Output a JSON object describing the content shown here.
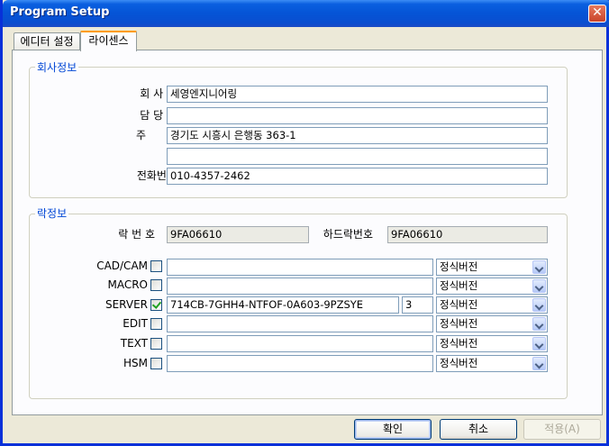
{
  "window": {
    "title": "Program Setup",
    "close_label": "✕"
  },
  "tabs": [
    {
      "label": "에디터 설정",
      "active": false
    },
    {
      "label": "라이센스",
      "active": true
    }
  ],
  "company": {
    "group_title": "회사정보",
    "name_label": "회 사 명",
    "name_value": "세영엔지니어링",
    "manager_label": "담 당 장",
    "manager_value": "",
    "address_label": "주      소",
    "address1_value": "경기도 시흥시 은행동 363-1",
    "address2_value": "",
    "phone_label": "전화번호",
    "phone_value": "010-4357-2462"
  },
  "lock": {
    "group_title": "락정보",
    "lock_no_label": "락 번 호",
    "lock_no_value": "9FA06610",
    "hw_lock_label": "하드락번호",
    "hw_lock_value": "9FA06610",
    "modules": [
      {
        "name": "CAD/CAM",
        "checked": false,
        "key": "",
        "count": null,
        "version": "정식버전"
      },
      {
        "name": "MACRO",
        "checked": false,
        "key": "",
        "count": null,
        "version": "정식버전"
      },
      {
        "name": "SERVER",
        "checked": true,
        "key": "714CB-7GHH4-NTFOF-0A603-9PZSYE",
        "count": "3",
        "version": "정식버전"
      },
      {
        "name": "EDIT",
        "checked": false,
        "key": "",
        "count": null,
        "version": "정식버전"
      },
      {
        "name": "TEXT",
        "checked": false,
        "key": "",
        "count": null,
        "version": "정식버전"
      },
      {
        "name": "HSM",
        "checked": false,
        "key": "",
        "count": null,
        "version": "정식버전"
      }
    ]
  },
  "buttons": {
    "ok": "확인",
    "cancel": "취소",
    "apply": "적용(A)"
  },
  "colors": {
    "titlebar": "#0554d6",
    "group_title": "#0046d5",
    "tab_highlight": "#ff9c00"
  }
}
